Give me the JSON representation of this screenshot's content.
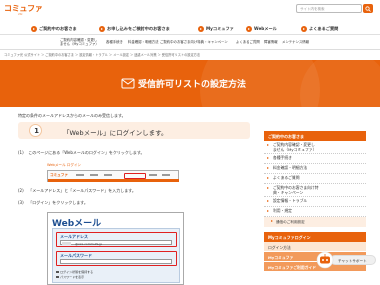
{
  "header": {
    "logo": "コミュファ",
    "logo_sub": "ctc",
    "search_placeholder": "サイト内を検索"
  },
  "main_nav": [
    {
      "label": "ご契約中のお客さま"
    },
    {
      "label": "お申し込みをご検討中のお客さま"
    },
    {
      "label": "Myコミュファ"
    },
    {
      "label": "Webメール"
    },
    {
      "label": "よくあるご質問"
    }
  ],
  "sub_nav": [
    {
      "line1": "ご契約内容確認・変更し",
      "line2": "ません（Myコミュファ）"
    },
    {
      "line1": "各種手続き",
      "line2": ""
    },
    {
      "line1": "料金確認・明細方法",
      "line2": ""
    },
    {
      "line1": "ご契約中のお客さま向け特典・キャンペーン",
      "line2": ""
    },
    {
      "line1": "よくあるご質問",
      "line2": ""
    },
    {
      "line1": "障害情報",
      "line2": ""
    },
    {
      "line1": "メンテナンス情報",
      "line2": ""
    }
  ],
  "breadcrumb": "コミュファ光 公式サイト ＞ ご契約中のお客さま ＞ 設定情報・トラブル ＞ メール設定 ＞ 迷惑メール対策 ＞ 受信許可リストの設定方法",
  "banner": {
    "title": "受信許可リストの設定方法",
    "color": "#e8620c"
  },
  "content": {
    "intro": "特定の条件のメールアドレスからのメールのみ受信します。",
    "step_number": "1",
    "step_title": "「Webメール」にログインします。",
    "instructions": [
      {
        "num": "(1)",
        "text": "このページにある「Webメールのログイン」をクリックします。"
      },
      {
        "num": "(2)",
        "text": "「メールアドレス」と「メールパスワード」を入力します。"
      },
      {
        "num": "(3)",
        "text": "「ログイン」をクリックします。"
      }
    ],
    "caption": "Webメール ログイン",
    "screenshot": {
      "title": "Webメール",
      "email_label": "メールアドレス",
      "email_value": "@xxx.commufa.jp",
      "password_label": "メールパスワード",
      "check1": "ログイン状態を保持する",
      "check2": "パスワードを表示"
    }
  },
  "sidebar": {
    "section1_head": "ご契約中のお客さま",
    "items": [
      {
        "label": "ご契約内容確認・変更し",
        "label2": "ません（Myコミュファ）"
      },
      {
        "label": "各種手続き",
        "label2": ""
      },
      {
        "label": "料金確認・明細方法",
        "label2": ""
      },
      {
        "label": "よくあるご質問",
        "label2": ""
      },
      {
        "label": "ご契約中のお客さま向け特",
        "label2": "典・キャンペーン"
      },
      {
        "label": "設定情報・トラブル",
        "label2": ""
      },
      {
        "label": "利用・規定",
        "label2": ""
      }
    ],
    "sub_item": "通信のご利用設定",
    "my_head": "Myコミュファログイン",
    "my_items": [
      {
        "label": "ログイン方法"
      },
      {
        "label": "Myコミュファ"
      },
      {
        "label": "Myコミュファご利用ガイド"
      }
    ]
  },
  "chat": {
    "label": "チャットサポート"
  }
}
